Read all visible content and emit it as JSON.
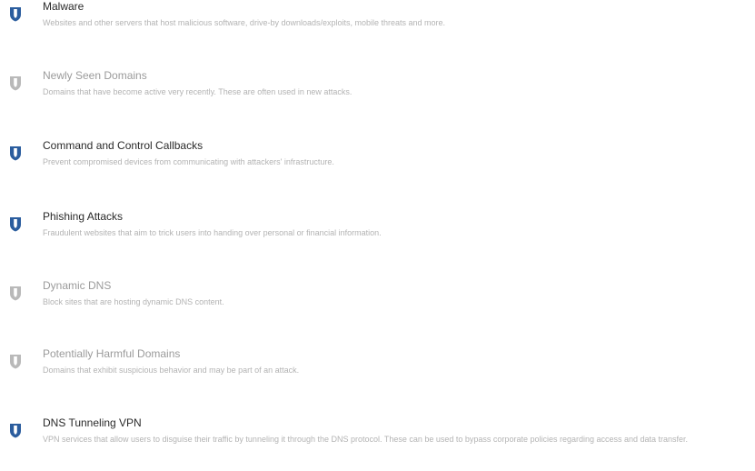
{
  "categories": [
    {
      "name": "Malware",
      "description": "Websites and other servers that host malicious software, drive-by downloads/exploits, mobile threats and more.",
      "enabled": true
    },
    {
      "name": "Newly Seen Domains",
      "description": "Domains that have become active very recently. These are often used in new attacks.",
      "enabled": false
    },
    {
      "name": "Command and Control Callbacks",
      "description": "Prevent compromised devices from communicating with attackers' infrastructure.",
      "enabled": true
    },
    {
      "name": "Phishing Attacks",
      "description": "Fraudulent websites that aim to trick users into handing over personal or financial information.",
      "enabled": true
    },
    {
      "name": "Dynamic DNS",
      "description": "Block sites that are hosting dynamic DNS content.",
      "enabled": false
    },
    {
      "name": "Potentially Harmful Domains",
      "description": "Domains that exhibit suspicious behavior and may be part of an attack.",
      "enabled": false
    },
    {
      "name": "DNS Tunneling VPN",
      "description": "VPN services that allow users to disguise their traffic by tunneling it through the DNS protocol. These can be used to bypass corporate policies regarding access and data transfer.",
      "enabled": true
    }
  ],
  "colors": {
    "shield_on": "#2b5d9e",
    "shield_on_inner": "#ffffff",
    "shield_off": "#b9b9b9",
    "shield_off_inner": "#ffffff"
  },
  "icons": {
    "toggle": "shield-icon"
  }
}
